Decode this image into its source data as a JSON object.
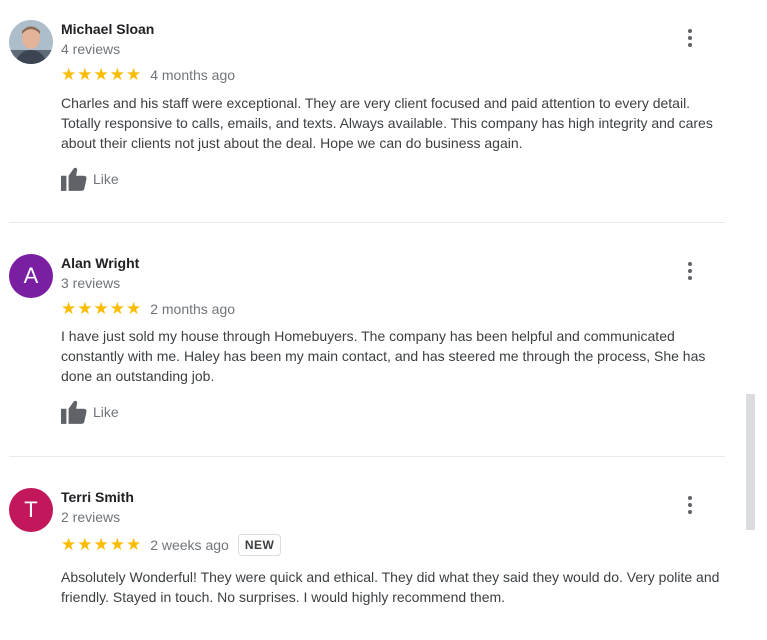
{
  "reviews": [
    {
      "author": "Michael Sloan",
      "count": "4 reviews",
      "stars": "★★★★★",
      "date": "4 months ago",
      "text": "Charles and his staff were exceptional.  They are very client focused and paid attention to every detail.  Totally responsive to calls, emails, and texts.  Always available. This company has high integrity and cares about their clients not just about the deal.  Hope we can do business again.",
      "like_label": "Like"
    },
    {
      "author": "Alan Wright",
      "avatar_letter": "A",
      "avatar_color": "#7b1fa2",
      "count": "3 reviews",
      "stars": "★★★★★",
      "date": "2 months ago",
      "text": "I have just sold my house through Homebuyers. The company has been helpful and communicated constantly with me. Haley has been my main contact, and has steered me through the process, She has done an outstanding job.",
      "like_label": "Like"
    },
    {
      "author": "Terri Smith",
      "avatar_letter": "T",
      "avatar_color": "#c2185b",
      "count": "2 reviews",
      "stars": "★★★★★",
      "date": "2 weeks ago",
      "badge": "NEW",
      "text": "Absolutely Wonderful! They were quick and ethical. They did what they said they would do. Very polite and friendly. Stayed in touch. No surprises. I would highly recommend them."
    }
  ],
  "colors": {
    "star": "#fbbc04",
    "secondary_text": "#70757a",
    "divider": "#e8eaed"
  },
  "icons": {
    "menu": "more-vert-icon",
    "like": "thumb-up-icon",
    "rating": "star-icon"
  }
}
